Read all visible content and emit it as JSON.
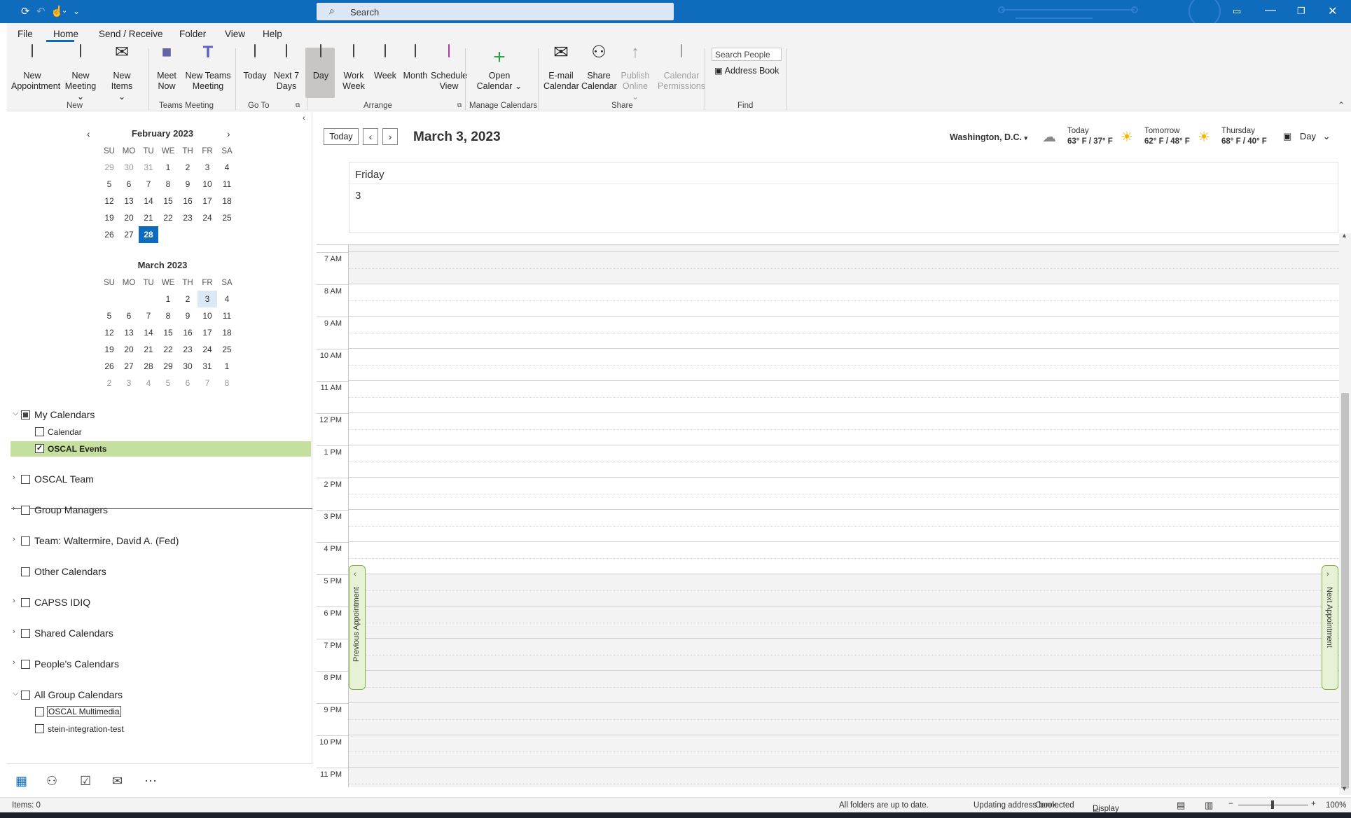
{
  "titlebar": {
    "search_placeholder": "Search"
  },
  "menu": {
    "tabs": [
      "File",
      "Home",
      "Send / Receive",
      "Folder",
      "View",
      "Help"
    ]
  },
  "ribbon": {
    "new_appointment": "New Appointment",
    "new_meeting": "New Meeting",
    "new_items": "New Items",
    "meet_now": "Meet Now",
    "new_teams_meeting": "New Teams Meeting",
    "today": "Today",
    "next_7_days": "Next 7 Days",
    "day": "Day",
    "work_week": "Work Week",
    "week": "Week",
    "month": "Month",
    "schedule_view": "Schedule View",
    "open_calendar": "Open Calendar",
    "email_calendar": "E-mail Calendar",
    "share_calendar": "Share Calendar",
    "publish_online": "Publish Online",
    "calendar_permissions": "Calendar Permissions",
    "search_people": "Search People",
    "address_book": "Address Book",
    "groups": [
      "New",
      "Teams Meeting",
      "Go To",
      "Arrange",
      "Manage Calendars",
      "Share",
      "Find"
    ]
  },
  "mini_calendars": {
    "day_headers": [
      "SU",
      "MO",
      "TU",
      "WE",
      "TH",
      "FR",
      "SA"
    ],
    "feb": {
      "title": "February 2023",
      "days": [
        "29",
        "30",
        "31",
        "1",
        "2",
        "3",
        "4",
        "5",
        "6",
        "7",
        "8",
        "9",
        "10",
        "11",
        "12",
        "13",
        "14",
        "15",
        "16",
        "17",
        "18",
        "19",
        "20",
        "21",
        "22",
        "23",
        "24",
        "25",
        "26",
        "27",
        "28"
      ]
    },
    "mar": {
      "title": "March 2023",
      "days": [
        "",
        "",
        "",
        "1",
        "2",
        "3",
        "4",
        "5",
        "6",
        "7",
        "8",
        "9",
        "10",
        "11",
        "12",
        "13",
        "14",
        "15",
        "16",
        "17",
        "18",
        "19",
        "20",
        "21",
        "22",
        "23",
        "24",
        "25",
        "26",
        "27",
        "28",
        "29",
        "30",
        "31",
        "1",
        "2",
        "3",
        "4",
        "5",
        "6",
        "7",
        "8"
      ]
    }
  },
  "folders": {
    "my_calendars": "My Calendars",
    "calendar": "Calendar",
    "oscal_events": "OSCAL Events",
    "oscal_team": "OSCAL Team",
    "group_managers": "Group Managers",
    "team_waltermire": "Team: Waltermire, David A. (Fed)",
    "other_calendars": "Other Calendars",
    "capss_idiq": "CAPSS IDIQ",
    "shared_calendars": "Shared Calendars",
    "peoples_calendars": "People's Calendars",
    "all_group_calendars": "All Group Calendars",
    "oscal_multimedia": "OSCAL Multimedia",
    "stein_integration_test": "stein-integration-test"
  },
  "main": {
    "today_button": "Today",
    "date_title": "March 3, 2023",
    "location": "Washington, D.C.",
    "weather": [
      {
        "day": "Today",
        "temps": "63° F / 37° F"
      },
      {
        "day": "Tomorrow",
        "temps": "62° F / 48° F"
      },
      {
        "day": "Thursday",
        "temps": "68° F / 40° F"
      }
    ],
    "view_mode": "Day",
    "day_name": "Friday",
    "day_number": "3",
    "hours": [
      "7 AM",
      "8 AM",
      "9 AM",
      "10 AM",
      "11 AM",
      "12 PM",
      "1 PM",
      "2 PM",
      "3 PM",
      "4 PM",
      "5 PM",
      "6 PM",
      "7 PM",
      "8 PM",
      "9 PM",
      "10 PM",
      "11 PM"
    ],
    "previous_appointment": "Previous Appointment",
    "next_appointment": "Next Appointment"
  },
  "status": {
    "items": "Items: 0",
    "sync": "All folders are up to date.",
    "updating": "Updating address book.",
    "connected": "Connected",
    "display_settings": "Display Settings",
    "zoom": "100%"
  },
  "colors": {
    "accent": "#0f6cbd",
    "selection_green": "#c5df9e",
    "appt_tab_border": "#7fb33c"
  }
}
